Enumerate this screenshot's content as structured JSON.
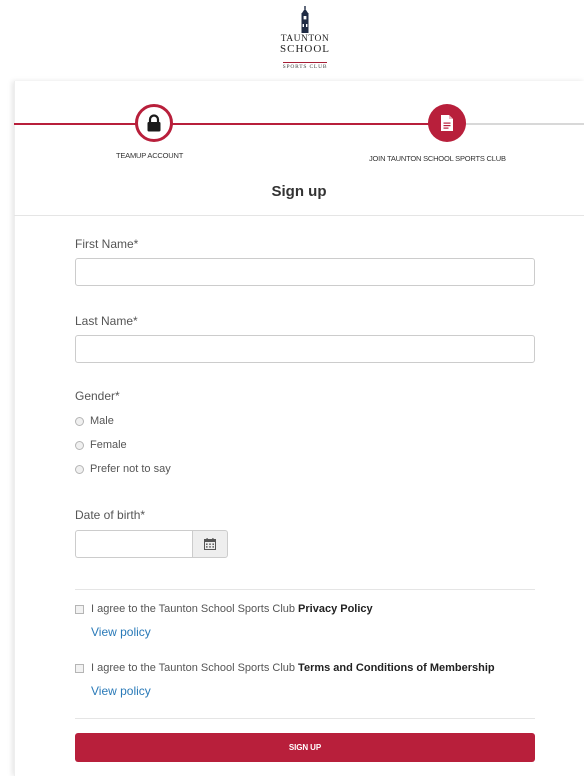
{
  "brand": {
    "line1": "TAUNTON",
    "line2": "SCHOOL",
    "line3": "SPORTS CLUB",
    "accent_color": "#b81f3b"
  },
  "steps": [
    {
      "label": "TEAMUP ACCOUNT",
      "icon": "lock-icon",
      "state": "done"
    },
    {
      "label": "JOIN TAUNTON SCHOOL SPORTS CLUB",
      "icon": "document-icon",
      "state": "active"
    }
  ],
  "page": {
    "title": "Sign up"
  },
  "form": {
    "first_name": {
      "label": "First Name*",
      "value": ""
    },
    "last_name": {
      "label": "Last Name*",
      "value": ""
    },
    "gender": {
      "label": "Gender*",
      "options": [
        "Male",
        "Female",
        "Prefer not to say"
      ]
    },
    "dob": {
      "label": "Date of birth*",
      "value": "",
      "icon": "calendar-icon"
    },
    "privacy": {
      "text": "I agree to the Taunton School Sports Club",
      "bold": "Privacy Policy",
      "link": "View policy"
    },
    "terms": {
      "text": "I agree to the Taunton School Sports Club",
      "bold": "Terms and Conditions of Membership",
      "link": "View policy"
    },
    "submit_label": "SIGN UP"
  }
}
